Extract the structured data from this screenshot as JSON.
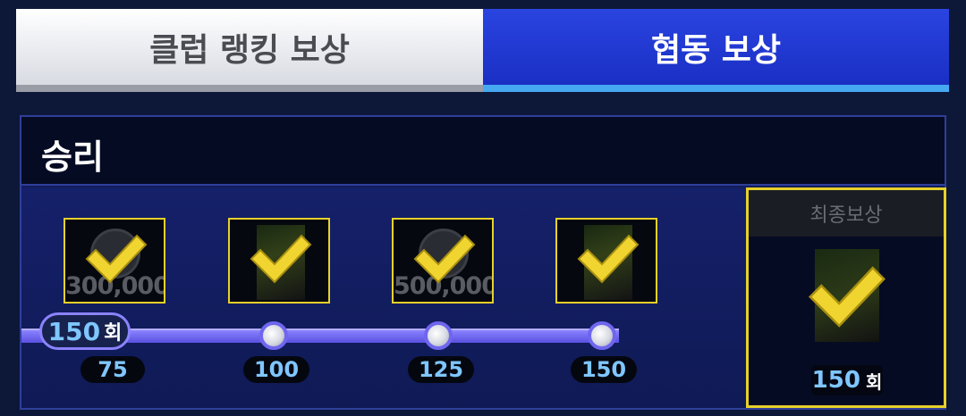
{
  "tabs": [
    {
      "label": "클럽 랭킹 보상",
      "active": false
    },
    {
      "label": "협동 보상",
      "active": true
    }
  ],
  "section": {
    "title": "승리",
    "current_progress": {
      "value": "150",
      "unit": "회"
    },
    "milestones": [
      {
        "label": "75",
        "reward_icon": "coin-icon",
        "reward_amount": "300,000",
        "claimed": true
      },
      {
        "label": "100",
        "reward_icon": "player-card-icon",
        "reward_amount": "",
        "claimed": true
      },
      {
        "label": "125",
        "reward_icon": "coin-icon",
        "reward_amount": "500,000",
        "claimed": true
      },
      {
        "label": "150",
        "reward_icon": "player-card-icon",
        "reward_amount": "",
        "claimed": true
      }
    ],
    "final_reward": {
      "title": "최종보상",
      "count": "150",
      "unit": "회",
      "reward_icon": "player-card-icon",
      "claimed": true
    }
  },
  "colors": {
    "background": "#0d1838",
    "active_tab": "#1f37d4",
    "tab_accent": "#47a8f2",
    "check": "#f0d430",
    "progress": "#6f66ef",
    "number": "#7fc6ff"
  }
}
